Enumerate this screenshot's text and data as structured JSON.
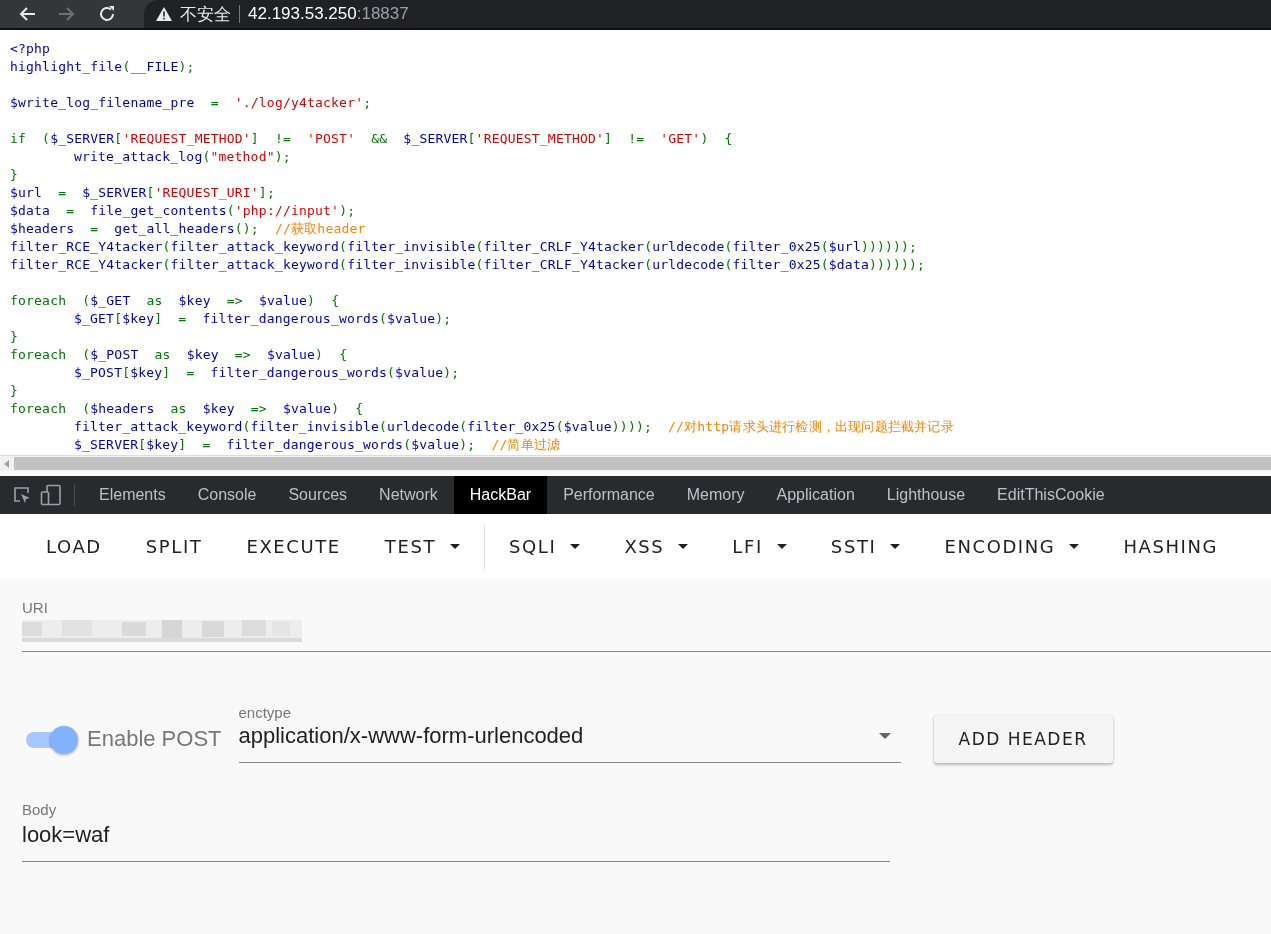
{
  "browser": {
    "nav": [
      {
        "kind": "back",
        "disabled": false
      },
      {
        "kind": "forward",
        "disabled": true
      },
      {
        "kind": "reload",
        "disabled": false
      }
    ],
    "address_bar": {
      "security_label": "不安全",
      "host": "42.193.53.250",
      "port": ":18837"
    }
  },
  "source_code": {
    "blocks": [
      {
        "lines": [
          {
            "tokens": [
              {
                "kind": "default",
                "text": "<?php"
              }
            ]
          },
          {
            "tokens": [
              {
                "kind": "default",
                "text": "highlight_file"
              },
              {
                "kind": "keyword",
                "text": "("
              },
              {
                "kind": "default",
                "text": "__FILE"
              },
              {
                "kind": "keyword",
                "text": ");"
              }
            ]
          }
        ]
      },
      {
        "lines": [
          {
            "tokens": [
              {
                "kind": "default",
                "text": "$write_log_filename_pre"
              },
              {
                "kind": "keyword",
                "text": "  =  "
              },
              {
                "kind": "string",
                "text": "'./log/y4tacker'"
              },
              {
                "kind": "keyword",
                "text": ";"
              }
            ]
          }
        ]
      },
      {
        "lines": [
          {
            "tokens": [
              {
                "kind": "keyword",
                "text": "if  ("
              },
              {
                "kind": "default",
                "text": "$_SERVER"
              },
              {
                "kind": "keyword",
                "text": "["
              },
              {
                "kind": "string",
                "text": "'REQUEST_METHOD'"
              },
              {
                "kind": "keyword",
                "text": "]  !=  "
              },
              {
                "kind": "string",
                "text": "'POST'"
              },
              {
                "kind": "keyword",
                "text": "  &&  "
              },
              {
                "kind": "default",
                "text": "$_SERVER"
              },
              {
                "kind": "keyword",
                "text": "["
              },
              {
                "kind": "string",
                "text": "'REQUEST_METHOD'"
              },
              {
                "kind": "keyword",
                "text": "]  !=  "
              },
              {
                "kind": "string",
                "text": "'GET'"
              },
              {
                "kind": "keyword",
                "text": ")  {"
              }
            ],
            "children": [
              {
                "tokens": [
                  {
                    "kind": "default",
                    "text": "write_attack_log"
                  },
                  {
                    "kind": "keyword",
                    "text": "("
                  },
                  {
                    "kind": "string",
                    "text": "\"method\""
                  },
                  {
                    "kind": "keyword",
                    "text": ");"
                  }
                ]
              }
            ]
          },
          {
            "tokens": [
              {
                "kind": "keyword",
                "text": "}"
              }
            ]
          },
          {
            "tokens": [
              {
                "kind": "default",
                "text": "$url"
              },
              {
                "kind": "keyword",
                "text": "  =  "
              },
              {
                "kind": "default",
                "text": "$_SERVER"
              },
              {
                "kind": "keyword",
                "text": "["
              },
              {
                "kind": "string",
                "text": "'REQUEST_URI'"
              },
              {
                "kind": "keyword",
                "text": "];"
              }
            ]
          },
          {
            "tokens": [
              {
                "kind": "default",
                "text": "$data"
              },
              {
                "kind": "keyword",
                "text": "  =  "
              },
              {
                "kind": "default",
                "text": "file_get_contents"
              },
              {
                "kind": "keyword",
                "text": "("
              },
              {
                "kind": "string",
                "text": "'php://input'"
              },
              {
                "kind": "keyword",
                "text": ");"
              }
            ]
          },
          {
            "tokens": [
              {
                "kind": "default",
                "text": "$headers"
              },
              {
                "kind": "keyword",
                "text": "  =  "
              },
              {
                "kind": "default",
                "text": "get_all_headers"
              },
              {
                "kind": "keyword",
                "text": "();  "
              },
              {
                "kind": "comment",
                "text": "//获取header"
              }
            ]
          },
          {
            "tokens": [
              {
                "kind": "default",
                "text": "filter_RCE_Y4tacker"
              },
              {
                "kind": "keyword",
                "text": "("
              },
              {
                "kind": "default",
                "text": "filter_attack_keyword"
              },
              {
                "kind": "keyword",
                "text": "("
              },
              {
                "kind": "default",
                "text": "filter_invisible"
              },
              {
                "kind": "keyword",
                "text": "("
              },
              {
                "kind": "default",
                "text": "filter_CRLF_Y4tacker"
              },
              {
                "kind": "keyword",
                "text": "("
              },
              {
                "kind": "default",
                "text": "urldecode"
              },
              {
                "kind": "keyword",
                "text": "("
              },
              {
                "kind": "default",
                "text": "filter_0x25"
              },
              {
                "kind": "keyword",
                "text": "("
              },
              {
                "kind": "default",
                "text": "$url"
              },
              {
                "kind": "keyword",
                "text": "))))));"
              }
            ]
          },
          {
            "tokens": [
              {
                "kind": "default",
                "text": "filter_RCE_Y4tacker"
              },
              {
                "kind": "keyword",
                "text": "("
              },
              {
                "kind": "default",
                "text": "filter_attack_keyword"
              },
              {
                "kind": "keyword",
                "text": "("
              },
              {
                "kind": "default",
                "text": "filter_invisible"
              },
              {
                "kind": "keyword",
                "text": "("
              },
              {
                "kind": "default",
                "text": "filter_CRLF_Y4tacker"
              },
              {
                "kind": "keyword",
                "text": "("
              },
              {
                "kind": "default",
                "text": "urldecode"
              },
              {
                "kind": "keyword",
                "text": "("
              },
              {
                "kind": "default",
                "text": "filter_0x25"
              },
              {
                "kind": "keyword",
                "text": "("
              },
              {
                "kind": "default",
                "text": "$data"
              },
              {
                "kind": "keyword",
                "text": "))))));"
              }
            ]
          }
        ]
      },
      {
        "lines": [
          {
            "tokens": [
              {
                "kind": "keyword",
                "text": "foreach  ("
              },
              {
                "kind": "default",
                "text": "$_GET"
              },
              {
                "kind": "keyword",
                "text": "  as  "
              },
              {
                "kind": "default",
                "text": "$key"
              },
              {
                "kind": "keyword",
                "text": "  =>  "
              },
              {
                "kind": "default",
                "text": "$value"
              },
              {
                "kind": "keyword",
                "text": ")  {"
              }
            ],
            "children": [
              {
                "tokens": [
                  {
                    "kind": "default",
                    "text": "$_GET"
                  },
                  {
                    "kind": "keyword",
                    "text": "["
                  },
                  {
                    "kind": "default",
                    "text": "$key"
                  },
                  {
                    "kind": "keyword",
                    "text": "]  =  "
                  },
                  {
                    "kind": "default",
                    "text": "filter_dangerous_words"
                  },
                  {
                    "kind": "keyword",
                    "text": "("
                  },
                  {
                    "kind": "default",
                    "text": "$value"
                  },
                  {
                    "kind": "keyword",
                    "text": ");"
                  }
                ]
              }
            ]
          },
          {
            "tokens": [
              {
                "kind": "keyword",
                "text": "}"
              }
            ]
          },
          {
            "tokens": [
              {
                "kind": "keyword",
                "text": "foreach  ("
              },
              {
                "kind": "default",
                "text": "$_POST"
              },
              {
                "kind": "keyword",
                "text": "  as  "
              },
              {
                "kind": "default",
                "text": "$key"
              },
              {
                "kind": "keyword",
                "text": "  =>  "
              },
              {
                "kind": "default",
                "text": "$value"
              },
              {
                "kind": "keyword",
                "text": ")  {"
              }
            ],
            "children": [
              {
                "tokens": [
                  {
                    "kind": "default",
                    "text": "$_POST"
                  },
                  {
                    "kind": "keyword",
                    "text": "["
                  },
                  {
                    "kind": "default",
                    "text": "$key"
                  },
                  {
                    "kind": "keyword",
                    "text": "]  =  "
                  },
                  {
                    "kind": "default",
                    "text": "filter_dangerous_words"
                  },
                  {
                    "kind": "keyword",
                    "text": "("
                  },
                  {
                    "kind": "default",
                    "text": "$value"
                  },
                  {
                    "kind": "keyword",
                    "text": ");"
                  }
                ]
              }
            ]
          },
          {
            "tokens": [
              {
                "kind": "keyword",
                "text": "}"
              }
            ]
          },
          {
            "tokens": [
              {
                "kind": "keyword",
                "text": "foreach  ("
              },
              {
                "kind": "default",
                "text": "$headers"
              },
              {
                "kind": "keyword",
                "text": "  as  "
              },
              {
                "kind": "default",
                "text": "$key"
              },
              {
                "kind": "keyword",
                "text": "  =>  "
              },
              {
                "kind": "default",
                "text": "$value"
              },
              {
                "kind": "keyword",
                "text": ")  {"
              }
            ],
            "children": [
              {
                "tokens": [
                  {
                    "kind": "default",
                    "text": "filter_attack_keyword"
                  },
                  {
                    "kind": "keyword",
                    "text": "("
                  },
                  {
                    "kind": "default",
                    "text": "filter_invisible"
                  },
                  {
                    "kind": "keyword",
                    "text": "("
                  },
                  {
                    "kind": "default",
                    "text": "urldecode"
                  },
                  {
                    "kind": "keyword",
                    "text": "("
                  },
                  {
                    "kind": "default",
                    "text": "filter_0x25"
                  },
                  {
                    "kind": "keyword",
                    "text": "("
                  },
                  {
                    "kind": "default",
                    "text": "$value"
                  },
                  {
                    "kind": "keyword",
                    "text": "))));  "
                  },
                  {
                    "kind": "comment",
                    "text": "//对http请求头进行检测，出现问题拦截并记录"
                  }
                ]
              },
              {
                "tokens": [
                  {
                    "kind": "default",
                    "text": "$_SERVER"
                  },
                  {
                    "kind": "keyword",
                    "text": "["
                  },
                  {
                    "kind": "default",
                    "text": "$key"
                  },
                  {
                    "kind": "keyword",
                    "text": "]  =  "
                  },
                  {
                    "kind": "default",
                    "text": "filter_dangerous_words"
                  },
                  {
                    "kind": "keyword",
                    "text": "("
                  },
                  {
                    "kind": "default",
                    "text": "$value"
                  },
                  {
                    "kind": "keyword",
                    "text": ");  "
                  },
                  {
                    "kind": "comment",
                    "text": "//简单过滤"
                  }
                ]
              }
            ]
          }
        ]
      }
    ]
  },
  "devtools": {
    "tabs": [
      {
        "label": "Elements",
        "selected": false
      },
      {
        "label": "Console",
        "selected": false
      },
      {
        "label": "Sources",
        "selected": false
      },
      {
        "label": "Network",
        "selected": false
      },
      {
        "label": "HackBar",
        "selected": true
      },
      {
        "label": "Performance",
        "selected": false
      },
      {
        "label": "Memory",
        "selected": false
      },
      {
        "label": "Application",
        "selected": false
      },
      {
        "label": "Lighthouse",
        "selected": false
      },
      {
        "label": "EditThisCookie",
        "selected": false
      }
    ]
  },
  "hackbar": {
    "toolbar_groups": [
      [
        {
          "label": "LOAD",
          "dropdown": false
        },
        {
          "label": "SPLIT",
          "dropdown": false
        },
        {
          "label": "EXECUTE",
          "dropdown": false
        },
        {
          "label": "TEST",
          "dropdown": true
        }
      ],
      [
        {
          "label": "SQLI",
          "dropdown": true
        },
        {
          "label": "XSS",
          "dropdown": true
        },
        {
          "label": "LFI",
          "dropdown": true
        },
        {
          "label": "SSTI",
          "dropdown": true
        },
        {
          "label": "ENCODING",
          "dropdown": true
        },
        {
          "label": "HASHING",
          "dropdown": false
        }
      ]
    ],
    "uri": {
      "label": "URI"
    },
    "enable_post": {
      "label": "Enable POST",
      "on": true
    },
    "enctype": {
      "label": "enctype",
      "value": "application/x-www-form-urlencoded"
    },
    "add_header_button": "ADD HEADER",
    "body": {
      "label": "Body",
      "value": "look=waf"
    }
  }
}
